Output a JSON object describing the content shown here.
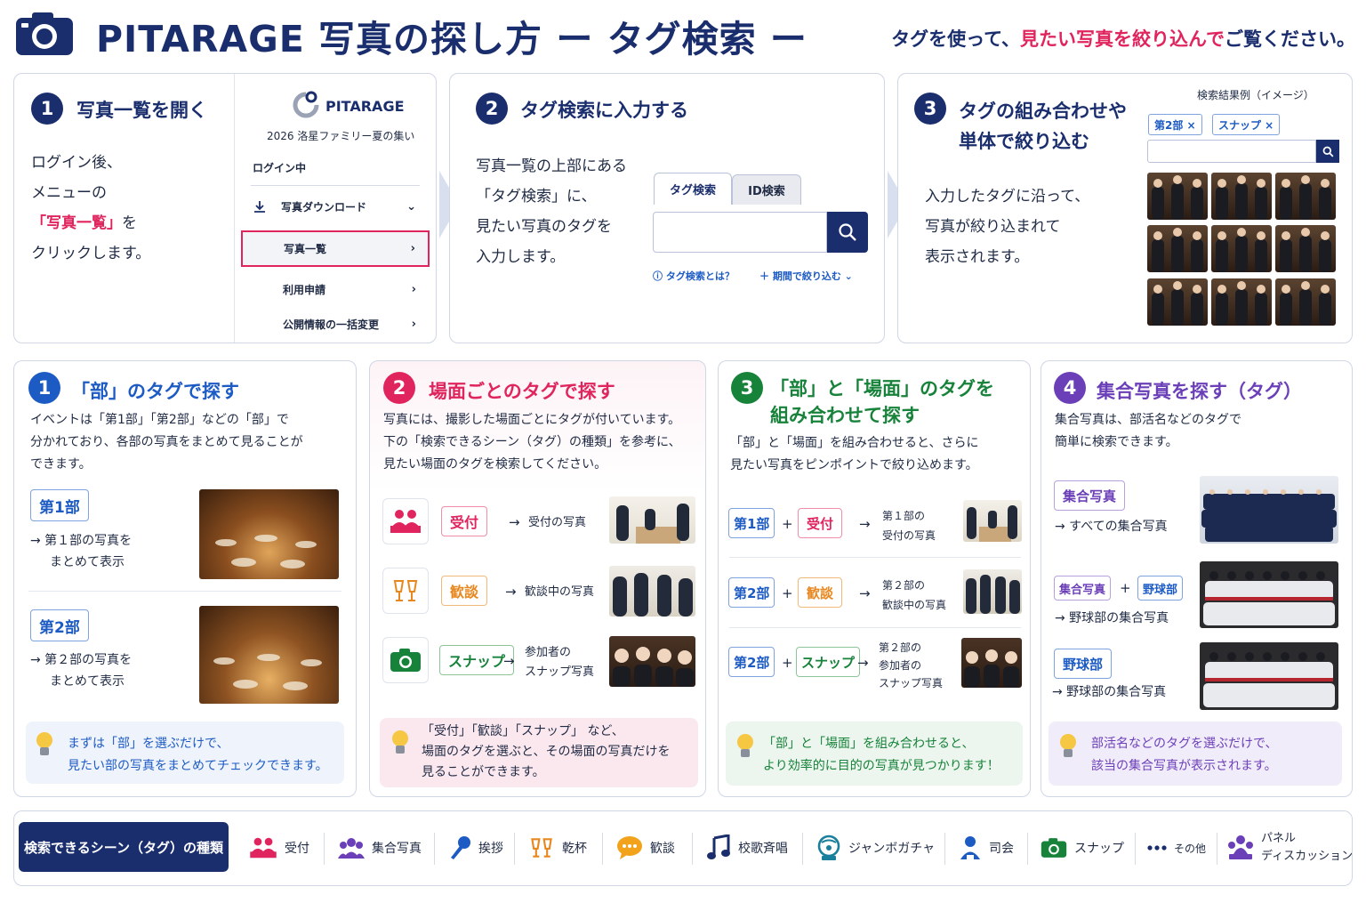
{
  "header": {
    "title": "PITARAGE 写真の探し方 ー タグ検索 ー",
    "subtitle_pre": "タグを使って、",
    "subtitle_highlight": "見たい写真を絞り込んで",
    "subtitle_post": "ご覧ください。"
  },
  "colors": {
    "navy": "#1a2e6e",
    "pink": "#e0245e",
    "blue": "#1d5bc4",
    "green": "#17823a",
    "purple": "#6b3fb8",
    "orange": "#e8871e"
  },
  "step1": {
    "num": "1",
    "title": "写真一覧を開く",
    "line1": "ログイン後、",
    "line2": "メニューの",
    "line3_hl": "「写真一覧」",
    "line3_post": "を",
    "line4": "クリックします。",
    "menu": {
      "logo": "PITARAGE",
      "event": "2026 洛星ファミリー夏の集い",
      "status": "ログイン中",
      "items": [
        "写真ダウンロード",
        "写真一覧",
        "利用申請",
        "公開情報の一括変更"
      ]
    }
  },
  "step2": {
    "num": "2",
    "title": "タグ検索に入力する",
    "line1": "写真一覧の上部にある",
    "line2": "「タグ検索」に、",
    "line3": "見たい写真のタグを",
    "line4": "入力します。",
    "tab_tag": "タグ検索",
    "tab_id": "ID検索",
    "help": "タグ検索とは？",
    "period": "期間で絞り込む"
  },
  "step3": {
    "num": "3",
    "title_line1": "タグの組み合わせや",
    "title_line2": "単体で絞り込む",
    "line1": "入力したタグに沿って、",
    "line2": "写真が絞り込まれて",
    "line3": "表示されます。",
    "example_label": "検索結果例（イメージ）",
    "chip1": "第2部 ×",
    "chip2": "スナップ ×"
  },
  "section1": {
    "num": "1",
    "title": "「部」のタグで探す",
    "desc1": "イベントは「第1部」「第2部」などの「部」で",
    "desc2": "分かれており、各部の写真をまとめて見ることが",
    "desc3": "できます。",
    "chip_a": "第1部",
    "result_a1": "→ 第１部の写真を",
    "result_a2": "まとめて表示",
    "chip_b": "第2部",
    "result_b1": "→ 第２部の写真を",
    "result_b2": "まとめて表示",
    "tip1": "まずは「部」を選ぶだけで、",
    "tip2": "見たい部の写真をまとめてチェックできます。"
  },
  "section2": {
    "num": "2",
    "title": "場面ごとのタグで探す",
    "desc1": "写真には、撮影した場面ごとにタグが付いています。",
    "desc2": "下の「検索できるシーン（タグ）の種類」を参考に、",
    "desc3": "見たい場面のタグを検索してください。",
    "rows": [
      {
        "tag": "受付",
        "result": "受付の写真",
        "result2": "",
        "icon": "reception-icon"
      },
      {
        "tag": "歓談",
        "result": "歓談中の写真",
        "result2": "",
        "icon": "toast-icon"
      },
      {
        "tag": "スナップ",
        "result": "参加者の",
        "result2": "スナップ写真",
        "icon": "camera-icon"
      }
    ],
    "tip1": "「受付」「歓談」「スナップ」 など、",
    "tip2": "場面のタグを選ぶと、その場面の写真だけを",
    "tip3": "見ることができます。"
  },
  "section3": {
    "num": "3",
    "title_line1": "「部」と「場面」のタグを",
    "title_line2": "組み合わせて探す",
    "desc1": "「部」と「場面」を組み合わせると、さらに",
    "desc2": "見たい写真をピンポイントで絞り込めます。",
    "rows": [
      {
        "a": "第1部",
        "b": "受付",
        "r1": "第１部の",
        "r2": "受付の写真",
        "r3": ""
      },
      {
        "a": "第2部",
        "b": "歓談",
        "r1": "第２部の",
        "r2": "歓談中の写真",
        "r3": ""
      },
      {
        "a": "第2部",
        "b": "スナップ",
        "r1": "第２部の",
        "r2": "参加者の",
        "r3": "スナップ写真"
      }
    ],
    "plus": "+",
    "arrow": "→",
    "tip1": "「部」と「場面」を組み合わせると、",
    "tip2": "より効率的に目的の写真が見つかります！"
  },
  "section4": {
    "num": "4",
    "title": "集合写真を探す（タグ）",
    "desc1": "集合写真は、部活名などのタグで",
    "desc2": "簡単に検索できます。",
    "chip_a": "集合写真",
    "result_a": "→ すべての集合写真",
    "chip_b1": "集合写真",
    "chip_b2": "野球部",
    "result_b": "→ 野球部の集合写真",
    "chip_c": "野球部",
    "result_c": "→ 野球部の集合写真",
    "tip1": "部活名などのタグを選ぶだけで、",
    "tip2": "該当の集合写真が表示されます。"
  },
  "legend": {
    "title": "検索できるシーン（タグ）の種類",
    "items": [
      {
        "label": "受付",
        "icon": "reception-icon"
      },
      {
        "label": "集合写真",
        "icon": "group-icon"
      },
      {
        "label": "挨拶",
        "icon": "microphone-icon"
      },
      {
        "label": "乾杯",
        "icon": "toast-icon"
      },
      {
        "label": "歓談",
        "icon": "chat-bubble-icon"
      },
      {
        "label": "校歌斉唱",
        "icon": "music-note-icon"
      },
      {
        "label": "ジャンボガチャ",
        "icon": "gacha-icon"
      },
      {
        "label": "司会",
        "icon": "person-icon"
      },
      {
        "label": "スナップ",
        "icon": "camera-icon"
      },
      {
        "label": "その他",
        "icon": "more-icon"
      },
      {
        "label_line1": "パネル",
        "label_line2": "ディスカッション",
        "icon": "panel-icon"
      }
    ]
  }
}
